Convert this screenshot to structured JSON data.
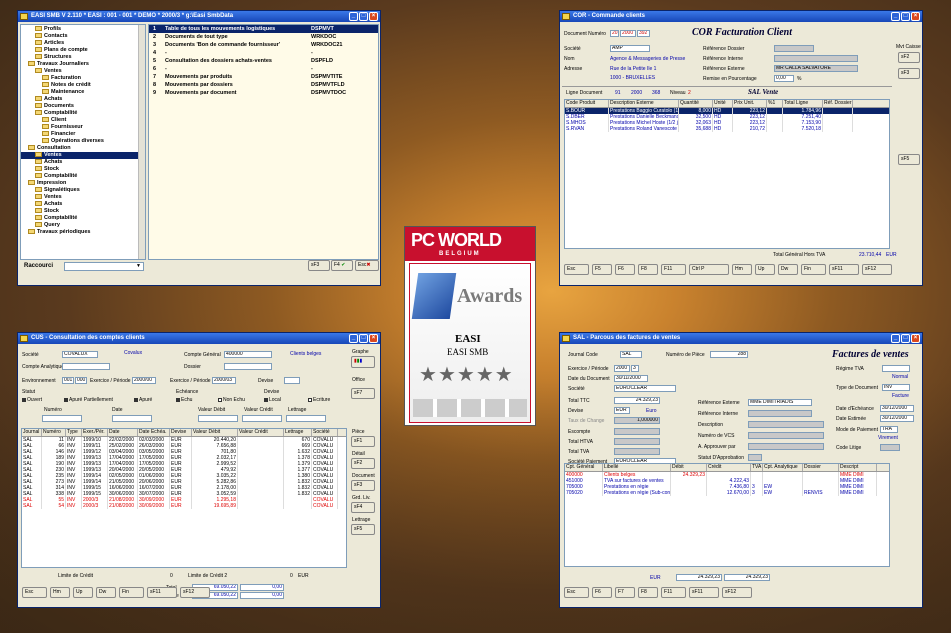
{
  "win_menu": {
    "title": "EASI SMB V 2.110 * EASI : 001 - 001 * DEMO * 2000/3 * g:\\Easi SmbData",
    "tree": [
      "Profils",
      "Contacts",
      "Articles",
      "Plans de compte",
      "Structures",
      "Travaux Journaliers",
      "Ventes",
      "Facturation",
      "Notes de crédit",
      "Maintenance",
      "Achats",
      "Documents",
      "Comptabilité",
      "Client",
      "Fournisseur",
      "Financier",
      "Opérations diverses",
      "Consultation",
      "Ventes",
      "Achats",
      "Stock",
      "Comptabilité",
      "Impression",
      "Signalétiques",
      "Ventes",
      "Achats",
      "Stock",
      "Comptabilité",
      "Query",
      "Travaux périodiques"
    ],
    "list": [
      {
        "n": "1",
        "t": "Table de tous les mouvements logistiques",
        "c": "DSPMVT"
      },
      {
        "n": "2",
        "t": "Documents de tout type",
        "c": "WRKDOC"
      },
      {
        "n": "3",
        "t": "Documents 'Bon de commande fournisseur'",
        "c": "WRKDOC21"
      },
      {
        "n": "4",
        "t": "-",
        "c": "-"
      },
      {
        "n": "5",
        "t": "Consultation des dossiers achats-ventes",
        "c": "DSPFLD"
      },
      {
        "n": "6",
        "t": "-",
        "c": "-"
      },
      {
        "n": "7",
        "t": "Mouvements par produits",
        "c": "DSPMVTITE"
      },
      {
        "n": "8",
        "t": "Mouvements par dossiers",
        "c": "DSPMVTFLD"
      },
      {
        "n": "9",
        "t": "Mouvements par document",
        "c": "DSPMVTDOC"
      }
    ],
    "raccourci": "Raccourci",
    "btn_f3": "sF3",
    "btn_f4": "F4",
    "btn_esc": "Esc"
  },
  "win_cor": {
    "title": "COR - Commande clients",
    "heading": "COR    Facturation Client",
    "doc_label": "Document Numéro",
    "doc_a": "20",
    "doc_b": "2000",
    "doc_c": "392",
    "societe_label": "Société",
    "societe": "AMP",
    "nom_label": "Nom",
    "nom": "Agence & Messageries de Presse",
    "adresse_label": "Adresse",
    "adresse1": "Rue de la Petite Ile 1",
    "adresse2": "1000 - BRUXELLES",
    "ref_dossier": "Référence Dossier",
    "ref_interne": "Référence Interne",
    "ref_externe": "Référence Externe",
    "ref_externe_val": "MR CALLA SALVATORE",
    "remise": "Remise en Pourcentage",
    "remise_val": "0,00",
    "pct": "%",
    "mvt_caisse": "Mvt Caisse",
    "ligne": "Ligne Document",
    "ligne_v1": "91",
    "ligne_v2": "2000",
    "ligne_v3": "368",
    "niveau": "Niveau",
    "niveau_v": "2",
    "sal": "SAL    Vente",
    "cols": [
      "Code Produit",
      "Description Externe",
      "Quantité",
      "Unité",
      "Prix Unit.",
      "%1",
      "Total Ligne",
      "Réf. Dossier"
    ],
    "rows": [
      [
        "S.BOUR",
        "Prestations Baggio Curatolo (1/2 j.",
        "8,000",
        "HD",
        "223,12",
        "",
        "1.784,96",
        ""
      ],
      [
        "S.DBER",
        "Prestations Danielle Beckmans (1/2",
        "32,500",
        "HD",
        "223,12",
        "",
        "7.251,40",
        ""
      ],
      [
        "S.MHOS",
        "Prestations Michel Hoste (1/2 jour)",
        "32,063",
        "HD",
        "223,12",
        "",
        "7.153,90",
        ""
      ],
      [
        "S.RVAN",
        "Prestations Roland Vanescote (1/2 j.",
        "35,688",
        "HD",
        "210,72",
        "",
        "7.520,18",
        ""
      ]
    ],
    "total_label": "Total Général Hors TVA",
    "total": "23.710,44",
    "cur": "EUR",
    "keys": [
      "Esc",
      "F5",
      "F6",
      "F8",
      "F11",
      "Ctrl P",
      "Hm",
      "Up",
      "Dw",
      "Fin",
      "sF11",
      "sF12"
    ]
  },
  "award": {
    "l1": "PC WORLD",
    "l2": "BELGIUM",
    "l3": "Awards",
    "l4": "EASI",
    "l5": "EASI SMB",
    "stars": 5
  },
  "win_cus": {
    "title": "CUS - Consultation des comptes clients",
    "societe_label": "Société",
    "societe": "COVALUX",
    "societe_name": "Covalux",
    "cpt_gen_label": "Compte Général",
    "cpt_gen": "400000",
    "cpt_gen_name": "Clients belges",
    "cpt_ana_label": "Compte Analytique",
    "dossier_label": "Dossier",
    "env_label": "Environnement",
    "env": "001",
    "env2": "000",
    "ex_label": "Exercice / Période",
    "ex": "2000/00",
    "ex2_label": "Exercice / Période",
    "ex2": "2000/03",
    "devise_label": "Devise",
    "graphe": "Graphe",
    "office": "Office",
    "statut": "Statut",
    "ouvert": "Ouvert",
    "apure_p": "Apuré Partiellement",
    "apure": "Apuré",
    "echeance": "Echéance",
    "echu": "Echu",
    "non_echu": "Non Echu",
    "devise2": "Devise",
    "local": "Local",
    "ecriture": "Ecriture",
    "numero": "Numéro",
    "date": "Date",
    "val_debit": "Valeur Débit",
    "val_credit": "Valeur Crédit",
    "lettrage": "Lettrage",
    "cols": [
      "Journal",
      "Numéro",
      "Type",
      "Exer./Pér.",
      "Date",
      "Date Echéa.",
      "Devise",
      "Valeur Débit",
      "Valeur Crédit",
      "Lettrage",
      "Société"
    ],
    "rows": [
      [
        "SAL",
        "11",
        "INV",
        "1999/10",
        "22/02/2000",
        "02/03/2000",
        "EUR",
        "20.440,20",
        "",
        "670",
        "COVALU"
      ],
      [
        "SAL",
        "66",
        "INV",
        "1999/11",
        "25/02/2000",
        "26/03/2000",
        "EUR",
        "7.656,88",
        "",
        "669",
        "COVALU"
      ],
      [
        "SAL",
        "146",
        "INV",
        "1999/12",
        "03/04/2000",
        "03/05/2000",
        "EUR",
        "701,80",
        "",
        "1.632",
        "COVALU"
      ],
      [
        "SAL",
        "189",
        "INV",
        "1999/13",
        "17/04/2000",
        "17/05/2000",
        "EUR",
        "2.032,17",
        "",
        "1.378",
        "COVALU"
      ],
      [
        "SAL",
        "190",
        "INV",
        "1999/13",
        "17/04/2000",
        "17/05/2000",
        "EUR",
        "2.999,52",
        "",
        "1.379",
        "COVALU"
      ],
      [
        "SAL",
        "230",
        "INV",
        "1999/13",
        "20/04/2000",
        "20/05/2000",
        "EUR",
        "479,92",
        "",
        "1.377",
        "COVALU"
      ],
      [
        "SAL",
        "235",
        "INV",
        "1999/14",
        "02/05/2000",
        "01/06/2000",
        "EUR",
        "3.035,22",
        "",
        "1.380",
        "COVALU"
      ],
      [
        "SAL",
        "273",
        "INV",
        "1999/14",
        "21/05/2000",
        "20/06/2000",
        "EUR",
        "5.282,86",
        "",
        "1.832",
        "COVALU"
      ],
      [
        "SAL",
        "314",
        "INV",
        "1999/15",
        "16/06/2000",
        "16/07/2000",
        "EUR",
        "2.178,00",
        "",
        "1.832",
        "COVALU"
      ],
      [
        "SAL",
        "338",
        "INV",
        "1999/15",
        "30/06/2000",
        "30/07/2000",
        "EUR",
        "3.052,59",
        "",
        "1.832",
        "COVALU"
      ],
      [
        "SAL",
        "55",
        "INV",
        "2000/3",
        "21/08/2000",
        "30/09/2000",
        "EUR",
        "1.295,18",
        "",
        "",
        "COVALU"
      ],
      [
        "SAL",
        "54",
        "INV",
        "2000/3",
        "21/08/2000",
        "30/09/2000",
        "EUR",
        "19.695,89",
        "",
        "",
        "COVALU"
      ]
    ],
    "side": [
      "Pièce",
      "Détail",
      "Document",
      "Grd. Liv.",
      "Lettrage"
    ],
    "limite": "Limite de Crédit",
    "limite_v": "0",
    "limite2": "Limite de Crédit 2",
    "limite2_v": "0",
    "eur": "EUR",
    "total": "Total",
    "total_d": "69.050,22",
    "total_c": "0,00",
    "solde": "Solde",
    "solde_d": "69.050,22",
    "solde_c": "0,00",
    "keys": [
      "Esc",
      "Hm",
      "Up",
      "Dw",
      "Fin",
      "sF11",
      "sF12"
    ]
  },
  "win_sal": {
    "title": "SAL - Parcous des factures de ventes",
    "heading": "Factures de ventes",
    "journal_label": "Journal Code",
    "journal": "SAL",
    "piece_label": "Numéro de Pièce",
    "piece": "288",
    "ex_label": "Exercice / Période",
    "ex": "2000",
    "ex_p": "3",
    "datedoc_label": "Date du Document",
    "datedoc": "30/11/2000",
    "societe_label": "Société",
    "societe": "EUROCLEAR",
    "regime_label": "Régime TVA",
    "regime": "Normal",
    "typedoc_label": "Type de Document",
    "typedoc": "INV",
    "typedoc_name": "Facture",
    "ttc_label": "Total TTC",
    "ttc": "24.329,23",
    "devise_label": "Devise",
    "devise": "EUR",
    "devise_name": "Euro",
    "taux_label": "Taux de Change",
    "taux": "1,000000",
    "escompte_label": "Escompte",
    "htva_label": "Total HTVA",
    "tva_label": "Total TVA",
    "soc_paie_label": "Société Paiement",
    "soc_paie": "EUROCLEAR",
    "refext_label": "Référence Externe",
    "refext": "MME DIMITRIADIS",
    "refint_label": "Référence Interne",
    "desc_label": "Description",
    "vcs_label": "Numéro de VCS",
    "approuver_label": "A. Approuver par",
    "statut_label": "Statut D'Approbation",
    "dateech_label": "Date d'Echéance",
    "dateech": "30/12/2000",
    "dateestim_label": "Date Estimée",
    "dateestim": "30/12/2000",
    "mode_label": "Mode de Paiement",
    "mode": "TRA",
    "mode_name": "Virement",
    "litige_label": "Code Litige",
    "cols": [
      "Cpt. Général",
      "Libellé",
      "Débit",
      "Crédit",
      "TVA",
      "Cpt. Analytique",
      "Dossier",
      "Descript"
    ],
    "rows": [
      [
        "400000",
        "Clients belges",
        "24.329,23",
        "",
        "",
        "",
        "",
        "MME DIMI"
      ],
      [
        "451000",
        "TVA sur factures de ventes",
        "",
        "4.222,43",
        "",
        "",
        "",
        "MME DIMI"
      ],
      [
        "705000",
        "Prestations en régie",
        "",
        "7.436,80",
        "3",
        "EW",
        "",
        "MME DIMI"
      ],
      [
        "705020",
        "Prestations en régie (Sub-contr",
        "",
        "12.670,00",
        "3",
        "EW",
        "RENVIS",
        "MME DIMI"
      ]
    ],
    "eur": "EUR",
    "tot_d": "24.329,23",
    "tot_c": "24.329,23",
    "keys": [
      "Esc",
      "F6",
      "F7",
      "F8",
      "F11",
      "sF11",
      "sF12"
    ]
  }
}
